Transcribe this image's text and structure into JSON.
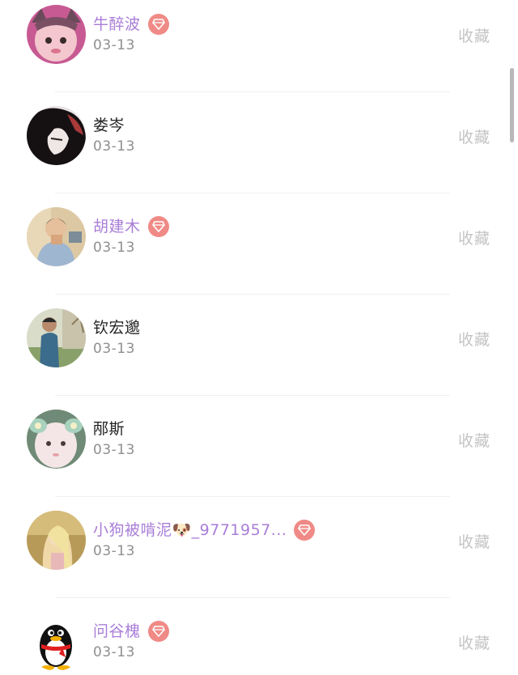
{
  "items": [
    {
      "name": "牛醉波",
      "date": "03-13",
      "vip": true,
      "action": "收藏",
      "avatar": "avatar-baby-cat-ears"
    },
    {
      "name": "娄岑",
      "date": "03-13",
      "vip": false,
      "action": "收藏",
      "avatar": "avatar-dark-hair"
    },
    {
      "name": "胡建木",
      "date": "03-13",
      "vip": true,
      "action": "收藏",
      "avatar": "avatar-boy-room"
    },
    {
      "name": "钦宏邈",
      "date": "03-13",
      "vip": false,
      "action": "收藏",
      "avatar": "avatar-man-outdoor"
    },
    {
      "name": "邴斯",
      "date": "03-13",
      "vip": false,
      "action": "收藏",
      "avatar": "avatar-baby-flower"
    },
    {
      "name": "小狗被啃泥🐶_9771957...",
      "date": "03-13",
      "vip": true,
      "action": "收藏",
      "avatar": "avatar-girl-golden"
    },
    {
      "name": "问谷槐",
      "date": "03-13",
      "vip": true,
      "action": "收藏",
      "avatar": "avatar-qq-penguin"
    }
  ],
  "colors": {
    "vip_name": "#a97ed8",
    "plain_name": "#222222",
    "vip_badge": "#f08a86",
    "date": "#8f8f8f",
    "action": "#c4c4c4",
    "divider": "#f0f0f0"
  }
}
